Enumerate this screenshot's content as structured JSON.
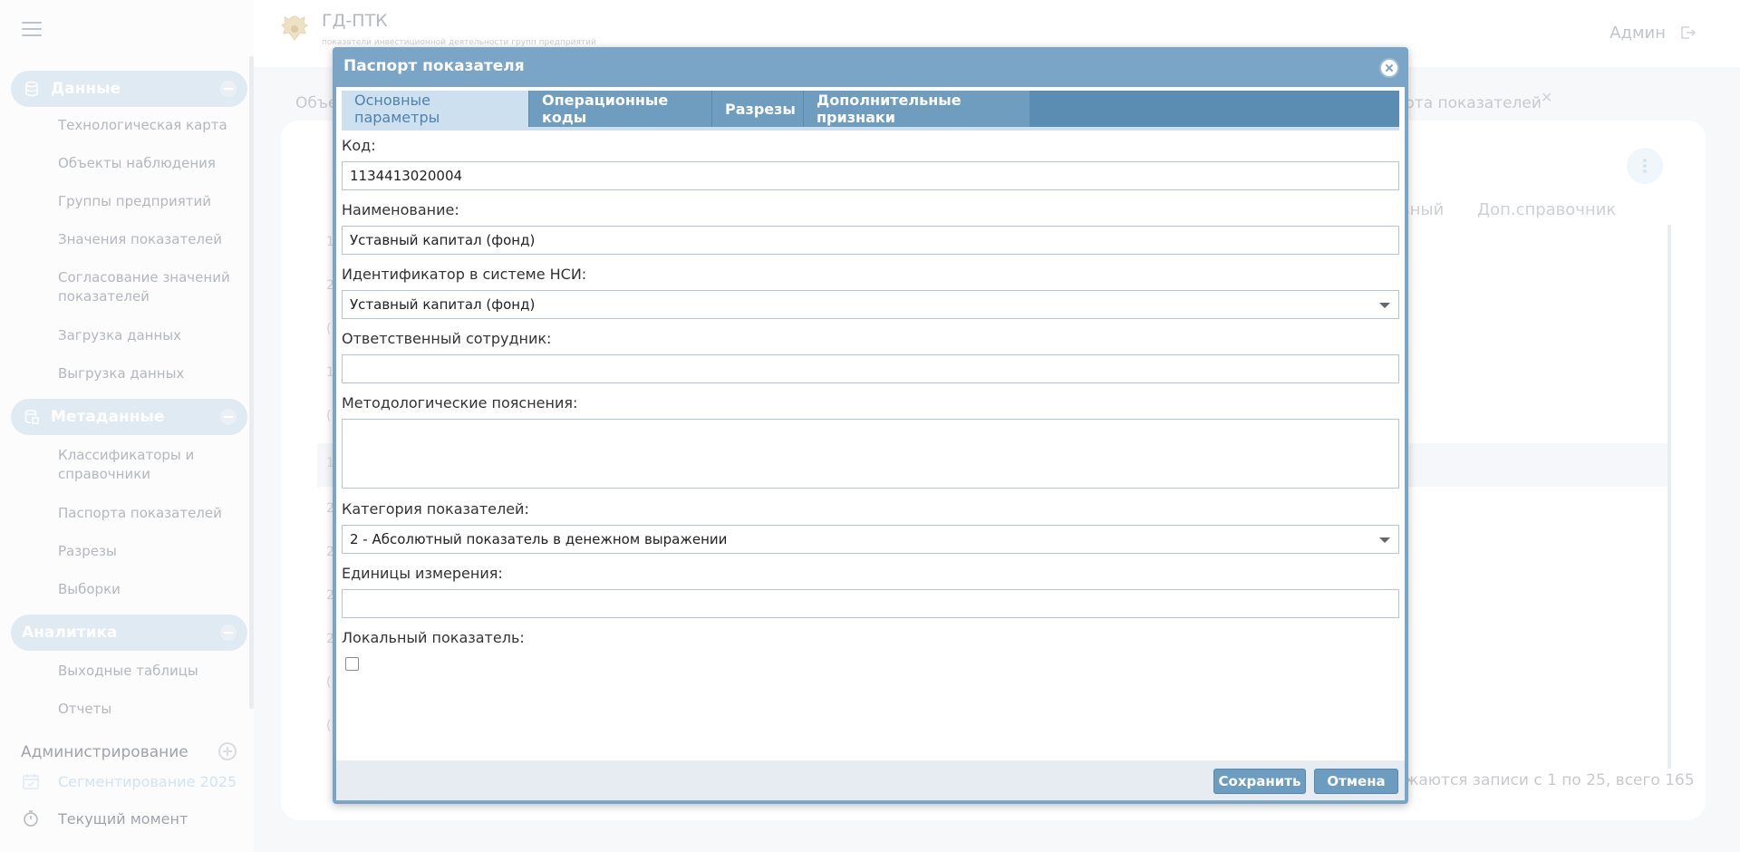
{
  "app": {
    "title": "ГД-ПТК",
    "subtitle": "показатели инвестиционной деятельности групп предприятий",
    "user": "Админ"
  },
  "sidebar": {
    "sections": [
      {
        "label": "Данные",
        "icon": "database-icon",
        "items": [
          "Технологическая карта",
          "Объекты наблюдения",
          "Группы предприятий",
          "Значения показателей",
          "Согласование значений показателей",
          "Загрузка данных",
          "Выгрузка данных"
        ]
      },
      {
        "label": "Метаданные",
        "icon": "metadata-icon",
        "items": [
          "Классификаторы и справочники",
          "Паспорта показателей",
          "Разрезы",
          "Выборки"
        ]
      },
      {
        "label": "Аналитика",
        "icon": "",
        "items": [
          "Выходные таблицы",
          "Отчеты"
        ]
      }
    ],
    "admin_label": "Администрирование",
    "segment_label": "Сегментирование 2025",
    "current_moment_label": "Текущий момент"
  },
  "background": {
    "tab_left": "Объе",
    "tab_right": "рта показателей",
    "col_1": "ьный",
    "col_2": "Доп.справочник",
    "pager": "жаются записи с 1 по 25, всего 165",
    "row_digits": [
      "1",
      "2",
      "(",
      "1",
      "(",
      "1",
      "2",
      "2",
      "2",
      "2",
      "(",
      "("
    ]
  },
  "modal": {
    "title": "Паспорт показателя",
    "tabs": [
      "Основные параметры",
      "Операционные коды",
      "Разрезы",
      "Дополнительные признаки"
    ],
    "fields": {
      "code_label": "Код:",
      "code_value": "1134413020004",
      "name_label": "Наименование:",
      "name_value": "Уставный капитал (фонд)",
      "nsi_label": "Идентификатор в системе НСИ:",
      "nsi_value": "Уставный капитал (фонд)",
      "responsible_label": "Ответственный сотрудник:",
      "responsible_value": "",
      "method_label": "Методологические пояснения:",
      "category_label": "Категория показателей:",
      "category_value": "2 - Абсолютный показатель в денежном выражении",
      "units_label": "Единицы измерения:",
      "units_value": "",
      "local_label": "Локальный показатель:",
      "local_checked": false
    },
    "save_label": "Сохранить",
    "cancel_label": "Отмена"
  }
}
